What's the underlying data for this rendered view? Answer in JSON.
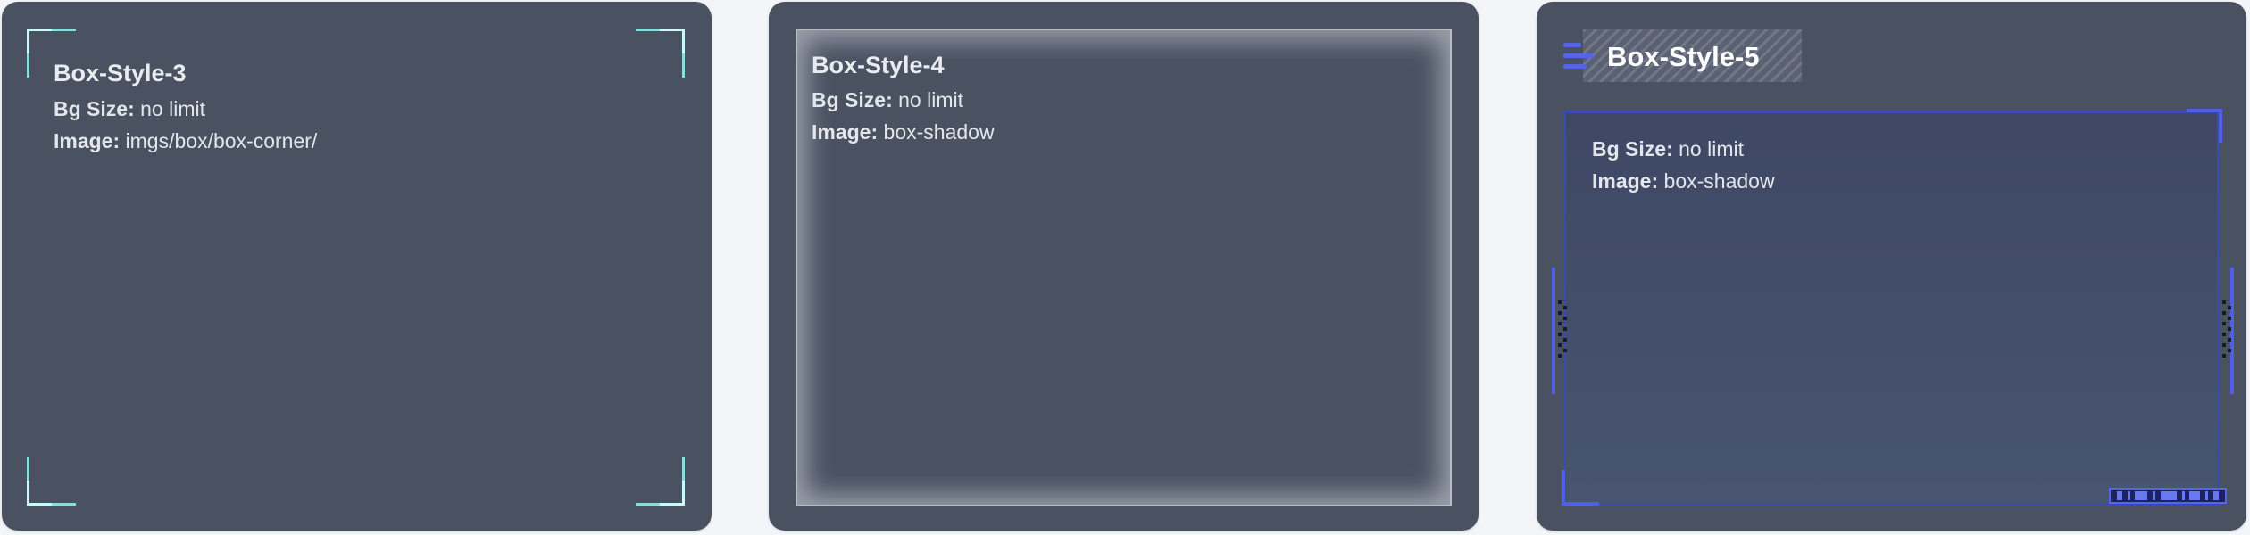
{
  "cards": [
    {
      "title": "Box-Style-3",
      "bg_label": "Bg Size:",
      "bg_value": "no limit",
      "image_label": "Image:",
      "image_value": "imgs/box/box-corner/"
    },
    {
      "title": "Box-Style-4",
      "bg_label": "Bg Size:",
      "bg_value": "no limit",
      "image_label": "Image:",
      "image_value": "box-shadow"
    },
    {
      "title": "Box-Style-5",
      "bg_label": "Bg Size:",
      "bg_value": "no limit",
      "image_label": "Image:",
      "image_value": "box-shadow"
    }
  ],
  "colors": {
    "card_bg": "#4a5262",
    "page_bg": "#f4f5f8",
    "corner_accent": "#8edbe0",
    "blue_accent": "#5466e8"
  }
}
